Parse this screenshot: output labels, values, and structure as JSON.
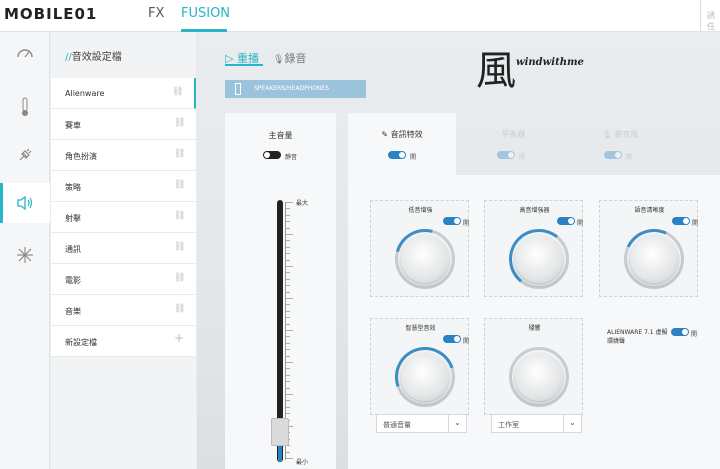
{
  "topbar": {
    "logo_text": "MOBILE01",
    "tab_fx": "FX",
    "tab_fusion": "FUSION",
    "search_hint": "誘任"
  },
  "iconbar": {
    "items": [
      "gauge-icon",
      "thermometer-icon",
      "power-plug-icon",
      "speaker-icon",
      "sparkle-icon"
    ],
    "active_index": 3
  },
  "profiles": {
    "heading_slashes": "//",
    "heading": "音效設定檔",
    "items": [
      {
        "label": "Alienware",
        "selected": true
      },
      {
        "label": "賽車"
      },
      {
        "label": "角色扮演"
      },
      {
        "label": "策略"
      },
      {
        "label": "射擊"
      },
      {
        "label": "通訊"
      },
      {
        "label": "電影"
      },
      {
        "label": "音樂"
      },
      {
        "label": "新設定檔",
        "action": "add"
      }
    ]
  },
  "main": {
    "tab_playback": "▷ 重播",
    "tab_record": "錄音",
    "device": "SPEAKERS/HEADPHONES",
    "brand_kanji": "風",
    "brand_text": "windwithme"
  },
  "volume": {
    "label": "主音量",
    "mute_label": "靜音",
    "mute_on": false,
    "max_label": "最大",
    "min_label": "最小",
    "level": 0.08
  },
  "effects": {
    "tabs": [
      {
        "label": "音訊特效",
        "toggle": "開",
        "enabled": true
      },
      {
        "label": "平衡器",
        "toggle": "開",
        "enabled": false
      },
      {
        "label": "麥克風",
        "toggle": "開",
        "enabled": false
      }
    ],
    "cards": [
      {
        "title": "低音增強",
        "toggle": "開",
        "level": 0.0
      },
      {
        "title": "高音增強器",
        "toggle": "開",
        "level": 0.12
      },
      {
        "title": "語音清晰度",
        "toggle": "開",
        "level": 0.05
      },
      {
        "title": "智慧型音效",
        "toggle": "開",
        "level": 0.28
      },
      {
        "title": "殘響",
        "toggle": "",
        "level": 0.0
      },
      {
        "title": "ALIENWARE 7.1 虛擬環繞聲",
        "toggle": "開"
      }
    ],
    "smart_volume_select": "普通音量",
    "reverb_select": "工作室"
  },
  "colors": {
    "accent": "#2ab4c8",
    "toggle_blue": "#2b82c3",
    "knob_ring_blue": "#3d8ec8"
  }
}
